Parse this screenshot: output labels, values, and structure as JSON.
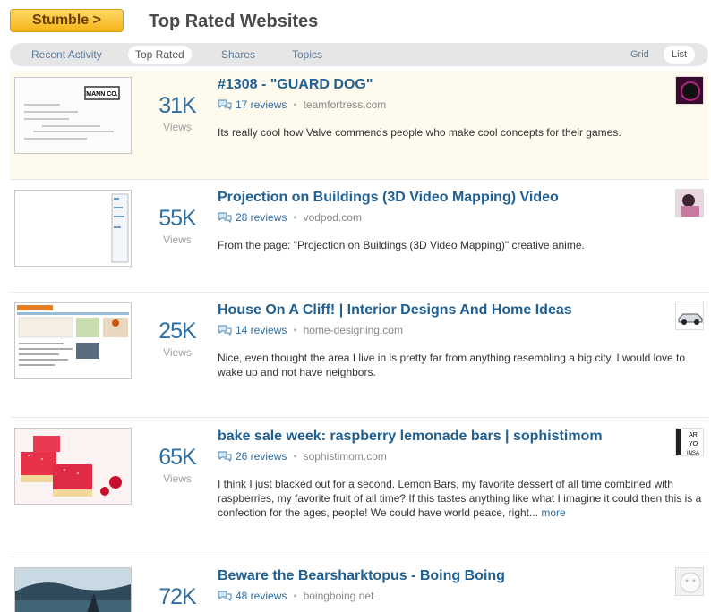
{
  "header": {
    "stumble_label": "Stumble >",
    "page_title": "Top Rated Websites"
  },
  "tabs": {
    "recent": "Recent Activity",
    "top_rated": "Top Rated",
    "shares": "Shares",
    "topics": "Topics",
    "grid": "Grid",
    "list": "List",
    "active": "Top Rated"
  },
  "views_label": "Views",
  "items": [
    {
      "views": "31K",
      "title": "#1308 - \"GUARD DOG\"",
      "reviews": "17 reviews",
      "domain": "teamfortress.com",
      "description": "Its really cool how Valve commends people who make cool concepts for their games.",
      "thumb_text": "MANN CO."
    },
    {
      "views": "55K",
      "title": "Projection on Buildings (3D Video Mapping) Video",
      "reviews": "28 reviews",
      "domain": "vodpod.com",
      "description": "From the page: \"Projection on Buildings (3D Video Mapping)\" creative anime."
    },
    {
      "views": "25K",
      "title": "House On A Cliff! | Interior Designs And Home Ideas",
      "reviews": "14 reviews",
      "domain": "home-designing.com",
      "description": "Nice, even thought the area I live in is pretty far from anything resembling a big city, I would love to wake up and not have neighbors."
    },
    {
      "views": "65K",
      "title": "bake sale week: raspberry lemonade bars | sophistimom",
      "reviews": "26 reviews",
      "domain": "sophistimom.com",
      "description": "I think I just blacked out for a second. Lemon Bars, my favorite dessert of all time combined with raspberries, my favorite fruit of all time? If this tastes anything like what I imagine it could then this is a confection for the ages, people! We could have world peace, right...",
      "more": "more",
      "avatar_text": [
        "AR",
        "YO",
        "INSA"
      ]
    },
    {
      "views": "72K",
      "title": "Beware the Bearsharktopus - Boing Boing",
      "reviews": "48 reviews",
      "domain": "boingboing.net"
    }
  ],
  "colors": {
    "accent": "#2d6ea3",
    "title": "#1f5f92",
    "stumble": "#f6b417",
    "highlight": "#fffaee"
  }
}
